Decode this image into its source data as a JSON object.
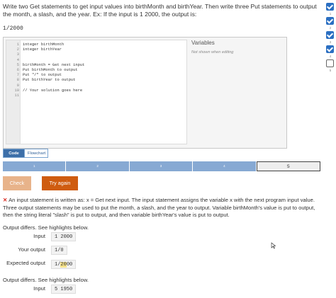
{
  "prompt": {
    "text": "Write two Get statements to get input values into birthMonth and birthYear. Then write three Put statements to output the month, a slash, and the year. Ex: If the input is 1 2000, the output is:",
    "example_output": "1/2000"
  },
  "progress_checks": {
    "items": [
      {
        "number": "1",
        "done": true
      },
      {
        "number": "2",
        "done": true
      },
      {
        "number": "3",
        "done": true
      },
      {
        "number": "4",
        "done": true
      },
      {
        "number": "5",
        "done": false
      }
    ]
  },
  "editor": {
    "lines": [
      {
        "num": "1",
        "code": "integer birthMonth"
      },
      {
        "num": "2",
        "code": "integer birthYear"
      },
      {
        "num": "3",
        "code": ""
      },
      {
        "num": "4",
        "code": ""
      },
      {
        "num": "5",
        "code": "birthMonth = Get next input"
      },
      {
        "num": "6",
        "code": "Put birthMonth to output"
      },
      {
        "num": "7",
        "code": "Put \"/\" to output"
      },
      {
        "num": "8",
        "code": "Put birthYear to output"
      },
      {
        "num": "9",
        "code": ""
      },
      {
        "num": "10",
        "code": "// Your solution goes here"
      },
      {
        "num": "11",
        "code": ""
      }
    ]
  },
  "variables_panel": {
    "title": "Variables",
    "note": "Not shown when editing"
  },
  "view_tabs": {
    "code": "Code",
    "flowchart": "Flowchart"
  },
  "levels": {
    "items": [
      "1",
      "2",
      "3",
      "4",
      "5"
    ],
    "current": "5"
  },
  "buttons": {
    "check": "Check",
    "try_again": "Try again"
  },
  "feedback": {
    "message": "An input statement is written as: x = Get next input. The input statement assigns the variable x with the next program input value. Three output statements may be used to put the month, a slash, and the year to output. Variable birthMonth's value is put to output, then the string literal \"slash\" is put to output, and then variable birthYear's value is put to output."
  },
  "diffs": [
    {
      "title": "Output differs. See highlights below.",
      "input_label": "Input",
      "input_value": "1 2000",
      "yours_label": "Your output",
      "yours_value": "1/0",
      "expected_label": "Expected output",
      "expected_prefix": "1/",
      "expected_highlight": "20",
      "expected_suffix": "00"
    },
    {
      "title": "Output differs. See highlights below.",
      "input_label": "Input",
      "input_value": "5 1950"
    }
  ],
  "colors": {
    "accent": "#2b6fc2",
    "try_again": "#cf5c10",
    "check_disabled": "#e8b38a",
    "level_bar": "#87a9d3",
    "error": "#d9261c",
    "highlight": "#f6e28a"
  }
}
